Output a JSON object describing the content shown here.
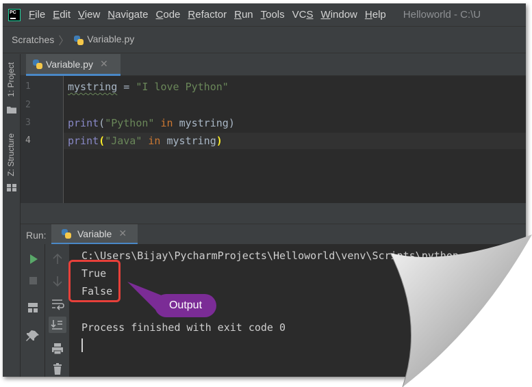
{
  "app": {
    "logo_text": "PC",
    "window_title": "Helloworld - C:\\U"
  },
  "menu": [
    {
      "mnemonic": "F",
      "rest": "ile"
    },
    {
      "mnemonic": "E",
      "rest": "dit"
    },
    {
      "mnemonic": "V",
      "rest": "iew"
    },
    {
      "mnemonic": "N",
      "rest": "avigate"
    },
    {
      "mnemonic": "C",
      "rest": "ode"
    },
    {
      "mnemonic": "R",
      "rest": "efactor"
    },
    {
      "mnemonic": "R",
      "rest": "un"
    },
    {
      "mnemonic": "T",
      "rest": "ools"
    },
    {
      "pre": "VC",
      "mnemonic": "S",
      "rest": ""
    },
    {
      "mnemonic": "W",
      "rest": "indow"
    },
    {
      "mnemonic": "H",
      "rest": "elp"
    }
  ],
  "breadcrumb": {
    "root": "Scratches",
    "file": "Variable.py"
  },
  "left_stripe": {
    "project_tab": "1: Project",
    "structure_tab": "Z: Structure"
  },
  "editor": {
    "tab_label": "Variable.py",
    "line_numbers": [
      "1",
      "2",
      "3",
      "4"
    ],
    "line1": {
      "var": "mystring",
      "op": " = ",
      "str": "\"I love Python\""
    },
    "line3": {
      "fn": "print",
      "open": "(",
      "str": "\"Python\"",
      "kw": " in ",
      "var": "mystring",
      "close": ")"
    },
    "line4": {
      "fn": "print",
      "open": "(",
      "str": "\"Java\"",
      "kw": " in ",
      "var": "mystring",
      "close": ")"
    }
  },
  "run": {
    "label": "Run:",
    "tab_label": "Variable",
    "console": {
      "command": "C:\\Users\\Bijay\\PycharmProjects\\Helloworld\\venv\\Scripts\\python.e",
      "out1": "True",
      "out2": "False",
      "exit_msg": "Process finished with exit code 0"
    }
  },
  "annotation": {
    "label": "Output",
    "box_color": "#e8403a",
    "callout_color": "#7b2c96"
  },
  "icons": {
    "run": "play-icon",
    "stop": "stop-icon",
    "up": "up-arrow-icon",
    "down": "down-arrow-icon",
    "wrap": "soft-wrap-icon",
    "scroll_end": "scroll-to-end-icon",
    "print": "print-icon",
    "trash": "trash-icon",
    "layout": "layout-icon",
    "pin": "pin-icon"
  }
}
